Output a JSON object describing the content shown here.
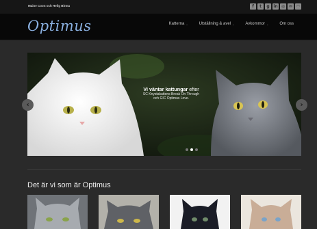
{
  "topbar": {
    "tagline": "Maine Coon och Helig Birma",
    "social_icons": [
      "facebook-icon",
      "twitter-icon",
      "google-plus-icon",
      "linkedin-icon",
      "instagram-icon",
      "mail-icon",
      "rss-icon"
    ]
  },
  "header": {
    "logo": "Optimus",
    "nav": [
      {
        "label": "Katterna",
        "dropdown": true
      },
      {
        "label": "Utställning & avel",
        "dropdown": true
      },
      {
        "label": "Avkommor",
        "dropdown": true
      },
      {
        "label": "Om oss",
        "dropdown": false
      }
    ]
  },
  "slider": {
    "headline_bold": "Vi väntar kattungar",
    "headline_rest": " efter",
    "sub_line1": "SC Knystakattens Break On Through",
    "sub_line2": "och GIC Optimus Love.",
    "slide_count": 3,
    "active_slide": 2
  },
  "section": {
    "title": "Det är vi som är Optimus"
  },
  "colors": {
    "logo": "#8ab0e0",
    "header_bg": "#080808",
    "page_bg": "#2a2a2a"
  }
}
